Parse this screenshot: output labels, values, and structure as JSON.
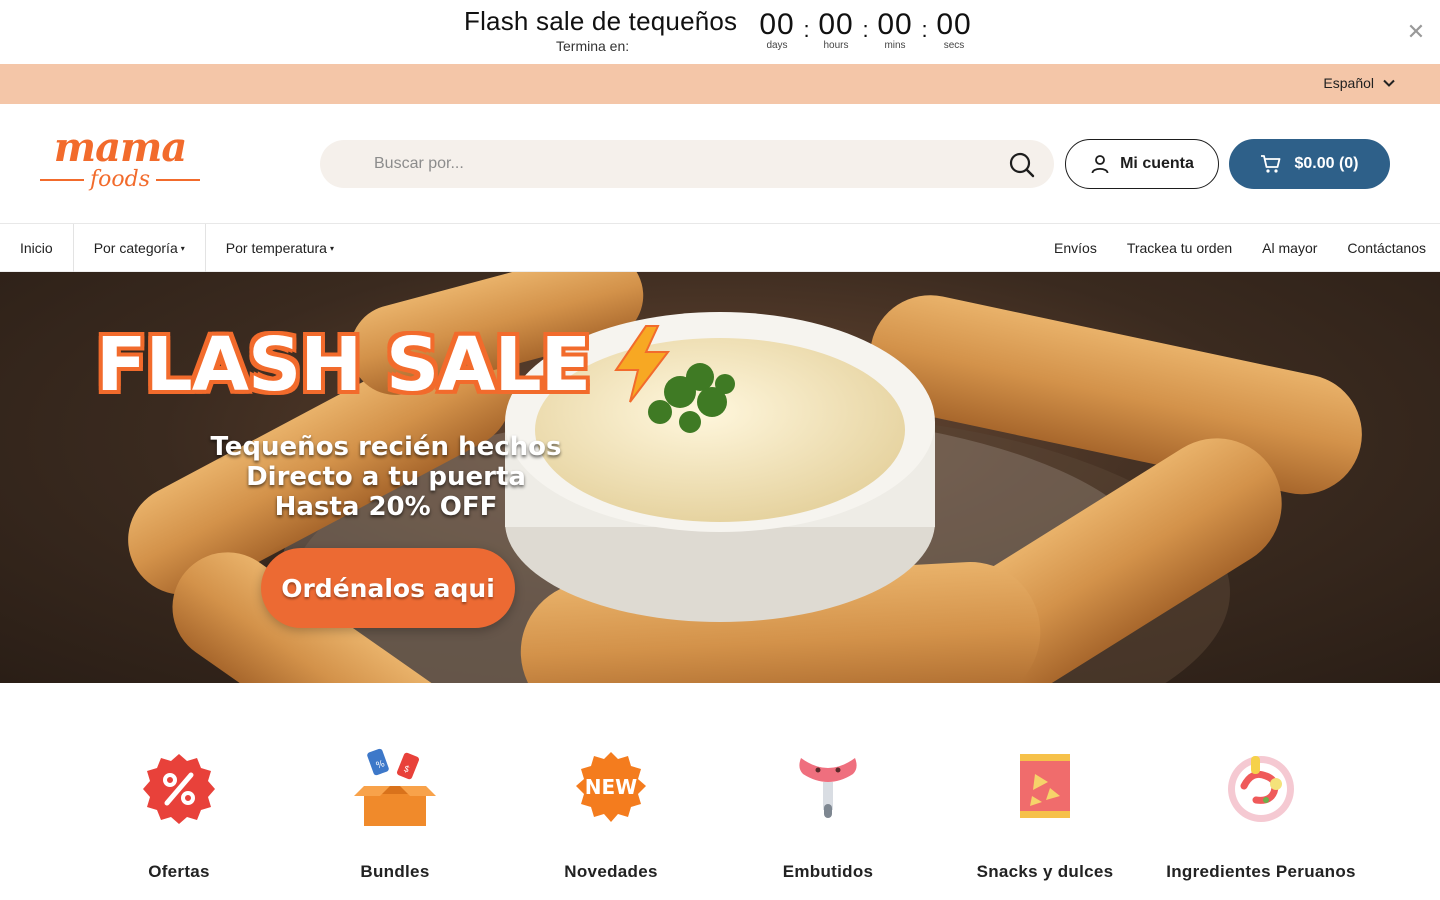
{
  "announcement": {
    "title": "Flash sale de tequeños",
    "subtitle": "Termina en:",
    "countdown": [
      {
        "value": "00",
        "label": "days"
      },
      {
        "value": "00",
        "label": "hours"
      },
      {
        "value": "00",
        "label": "mins"
      },
      {
        "value": "00",
        "label": "secs"
      }
    ],
    "separator": ":",
    "close_icon": "close-icon"
  },
  "language": {
    "current": "Español",
    "icon": "chevron-down-icon"
  },
  "header": {
    "logo_top": "mama",
    "logo_bottom": "foods",
    "search_placeholder": "Buscar por...",
    "account_label": "Mi cuenta",
    "cart_label": "$0.00 (0)"
  },
  "nav": {
    "left": [
      {
        "label": "Inicio",
        "caret": ""
      },
      {
        "label": "Por categoría",
        "caret": "▾"
      },
      {
        "label": "Por temperatura",
        "caret": "▾"
      }
    ],
    "right": [
      "Envíos",
      "Trackea tu orden",
      "Al mayor",
      "Contáctanos"
    ]
  },
  "hero": {
    "title": "FLASH SALE",
    "lines": [
      "Tequeños recién hechos",
      "Directo a tu puerta",
      "Hasta 20% OFF"
    ],
    "cta": "Ordénalos aqui"
  },
  "categories": [
    {
      "label": "Ofertas",
      "icon": "discount-badge-icon"
    },
    {
      "label": "Bundles",
      "icon": "box-with-tags-icon"
    },
    {
      "label": "Novedades",
      "icon": "new-badge-icon"
    },
    {
      "label": "Embutidos",
      "icon": "sausage-icon"
    },
    {
      "label": "Snacks y dulces",
      "icon": "snack-bag-icon"
    },
    {
      "label": "Ingredientes Peruanos",
      "icon": "peruvian-dish-icon"
    }
  ],
  "colors": {
    "brand_orange": "#f26b2c",
    "lang_bar": "#f4c6a8",
    "cart_blue": "#2e6089",
    "search_bg": "#f5f0eb"
  }
}
